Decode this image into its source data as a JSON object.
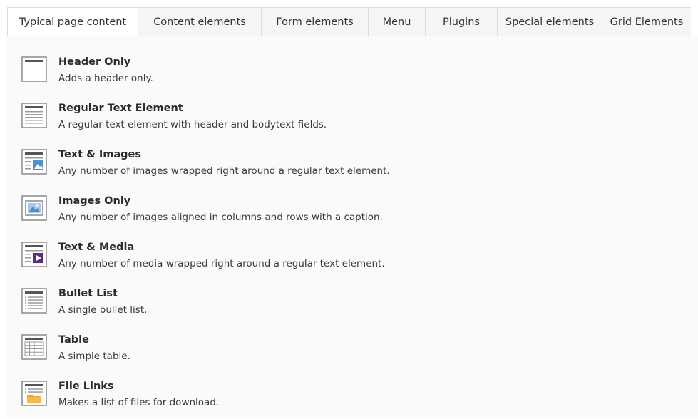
{
  "tabs": [
    {
      "label": "Typical page content",
      "active": true
    },
    {
      "label": "Content elements",
      "active": false
    },
    {
      "label": "Form elements",
      "active": false
    },
    {
      "label": "Menu",
      "active": false
    },
    {
      "label": "Plugins",
      "active": false
    },
    {
      "label": "Special elements",
      "active": false
    },
    {
      "label": "Grid Elements",
      "active": false
    }
  ],
  "items": [
    {
      "icon": "header-only-icon",
      "title": "Header Only",
      "description": "Adds a header only."
    },
    {
      "icon": "regular-text-icon",
      "title": "Regular Text Element",
      "description": "A regular text element with header and bodytext fields."
    },
    {
      "icon": "text-images-icon",
      "title": "Text & Images",
      "description": "Any number of images wrapped right around a regular text element."
    },
    {
      "icon": "images-only-icon",
      "title": "Images Only",
      "description": "Any number of images aligned in columns and rows with a caption."
    },
    {
      "icon": "text-media-icon",
      "title": "Text & Media",
      "description": "Any number of media wrapped right around a regular text element."
    },
    {
      "icon": "bullet-list-icon",
      "title": "Bullet List",
      "description": "A single bullet list."
    },
    {
      "icon": "table-icon",
      "title": "Table",
      "description": "A simple table."
    },
    {
      "icon": "file-links-icon",
      "title": "File Links",
      "description": "Makes a list of files for download."
    }
  ],
  "colors": {
    "icon_frame": "#8a8a8a",
    "icon_line": "#9a9a9a",
    "image_blue": "#4d90d6",
    "media_purple": "#5a2d82",
    "bullet_orange": "#f0a030",
    "folder_orange": "#f5a623"
  }
}
